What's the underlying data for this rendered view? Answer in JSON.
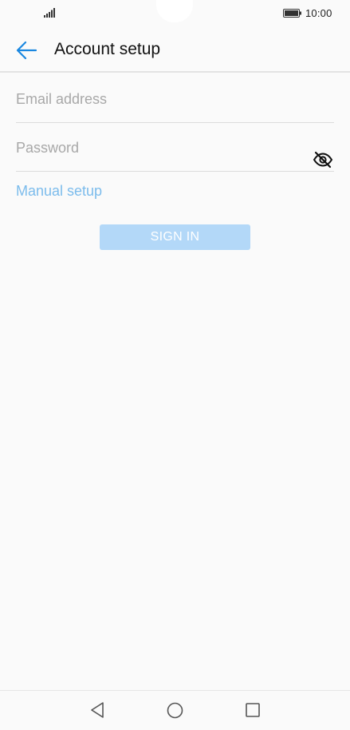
{
  "status_bar": {
    "time": "10:00",
    "icons": [
      "signal-icon",
      "battery-icon"
    ]
  },
  "app_bar": {
    "back_icon": "arrow-left-icon",
    "title": "Account setup"
  },
  "form": {
    "email": {
      "value": "",
      "placeholder": "Email address"
    },
    "password": {
      "value": "",
      "placeholder": "Password",
      "toggle_icon": "eye-off-icon"
    },
    "manual_setup_label": "Manual setup",
    "sign_in_label": "SIGN IN",
    "sign_in_enabled": false
  },
  "nav_bar": {
    "icons": [
      "nav-back-icon",
      "nav-home-icon",
      "nav-recent-icon"
    ]
  },
  "colors": {
    "accent": "#1a87e0",
    "link": "#7cbcec",
    "button_disabled": "#b3d8f8",
    "background": "#fafafa"
  }
}
